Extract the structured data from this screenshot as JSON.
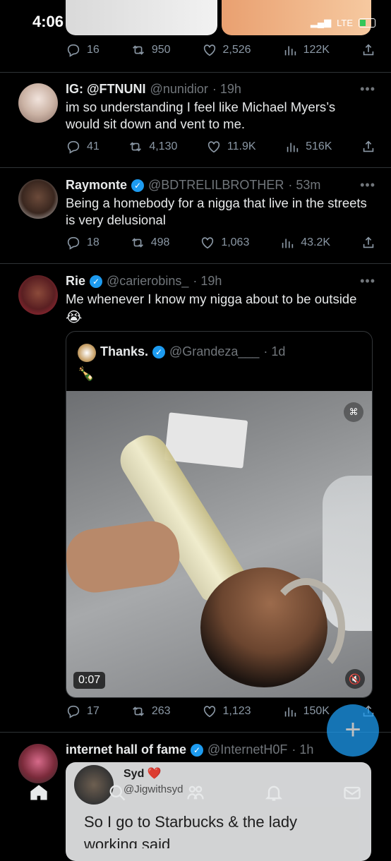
{
  "status_bar": {
    "time": "4:06",
    "network": "LTE"
  },
  "tweets": [
    {
      "stats": {
        "replies": "16",
        "retweets": "950",
        "likes": "2,526",
        "views": "122K"
      }
    },
    {
      "name": "IG: @FTNUNI",
      "handle": "@nunidior",
      "time": "· 19h",
      "text": "im so understanding I feel like Michael Myers’s would sit down and vent to me.",
      "stats": {
        "replies": "41",
        "retweets": "4,130",
        "likes": "11.9K",
        "views": "516K"
      }
    },
    {
      "name": "Raymonte",
      "handle": "@BDTRELILBROTHER",
      "time": "· 53m",
      "text": "Being a homebody for a nigga that live in  the streets is very delusional",
      "stats": {
        "replies": "18",
        "retweets": "498",
        "likes": "1,063",
        "views": "43.2K"
      }
    },
    {
      "name": "Rie",
      "handle": "@carierobins_",
      "time": "· 19h",
      "text": "Me whenever I know my nigga about to be outside",
      "emoji": "😭",
      "quote": {
        "name": "Thanks.",
        "handle": "@Grandeza___",
        "time": "· 1d",
        "text": "🍾",
        "duration": "0:07"
      },
      "stats": {
        "replies": "17",
        "retweets": "263",
        "likes": "1,123",
        "views": "150K"
      }
    },
    {
      "name": "internet hall of fame",
      "handle": "@InternetH0F",
      "time": "· 1h",
      "card": {
        "name": "Syd",
        "heart": "❤️",
        "handle": "@Jigwithsyd",
        "text": "So I go to Starbucks & the lady",
        "text2": "working said"
      }
    }
  ],
  "fab": {
    "label": "+"
  },
  "colors": {
    "accent": "#1d9bf0",
    "text": "#e7e9ea",
    "muted": "#71767b",
    "bg": "#000000"
  }
}
